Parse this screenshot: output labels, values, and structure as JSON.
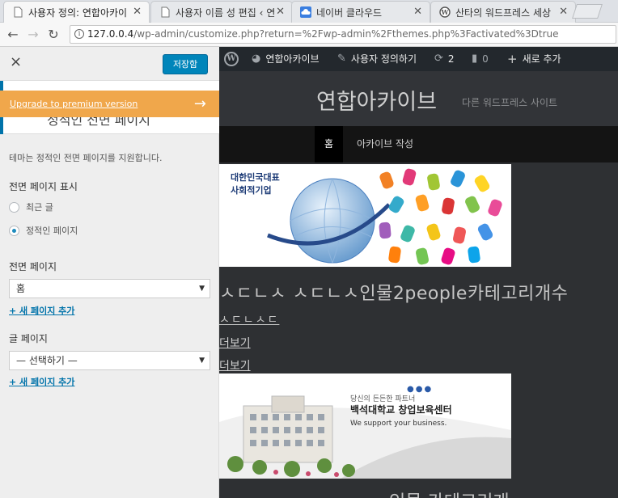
{
  "browser": {
    "tabs": [
      {
        "title": "사용자 정의: 연합아카이",
        "icon": "page-icon",
        "active": true
      },
      {
        "title": "사용자 이름 성 편집 ‹ 연",
        "icon": "page-icon",
        "active": false
      },
      {
        "title": "네이버 클라우드",
        "icon": "cloud-icon",
        "active": false
      },
      {
        "title": "산타의 워드프레스 세상",
        "icon": "wordpress-icon",
        "active": false
      }
    ],
    "url_host": "127.0.0.4",
    "url_path": "/wp-admin/customize.php?return=%2Fwp-admin%2Fthemes.php%3Factivated%3Dtrue"
  },
  "customizer": {
    "close_label": "×",
    "save_label": "저장함",
    "section_title": "정적인 전면 페이지",
    "upgrade_label": "Upgrade to premium version",
    "description": "테마는 정적인 전면 페이지를 지원합니다.",
    "front_display_label": "전면 페이지 표시",
    "radio_latest": "최근 글",
    "radio_static": "정적인 페이지",
    "front_page_label": "전면 페이지",
    "front_page_value": "홈",
    "add_page_link": "+ 새 페이지 추가",
    "posts_page_label": "글 페이지",
    "posts_page_value": "— 선택하기 —",
    "add_page_link2": "+ 새 페이지 추가"
  },
  "adminbar": {
    "site_name": "연합아카이브",
    "customize": "사용자 정의하기",
    "updates": "2",
    "comments": "0",
    "new": "새로 추가"
  },
  "site": {
    "title": "연합아카이브",
    "description": "다른 워드프레스 사이트",
    "menu": [
      "홈",
      "아카이브 작성"
    ]
  },
  "content": {
    "banner1_text": "대한민국대표\n사회적기업",
    "post_title": "ㅅㄷㄴㅅ ㅅㄷㄴㅅ인물2people카테고리개수",
    "post_category": "ㅅㄷㄴㅅㄷ",
    "more1": "더보기",
    "more2": "더보기",
    "banner2_small": "당신의 든든한 파트너",
    "banner2_big": "백석대학교 창업보육센터",
    "banner2_sub": "We support your business.",
    "banner2_dots": "●●●",
    "post_title2": "인물 카테고리개"
  },
  "colors": {
    "accent": "#0085ba",
    "upgrade": "#f0a74b",
    "admin_bar": "#23282d",
    "preview_bg": "#2e3033"
  }
}
